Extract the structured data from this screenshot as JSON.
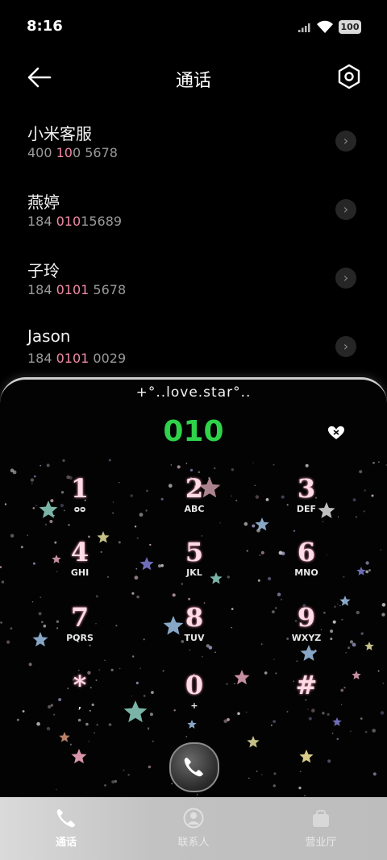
{
  "status": {
    "time": "8:16",
    "battery": "100"
  },
  "header": {
    "title": "通话"
  },
  "contacts": [
    {
      "name": "小米客服",
      "number_parts": [
        "400 ",
        "10",
        "0 5678"
      ]
    },
    {
      "name": "燕婷",
      "number_parts": [
        "184 ",
        "010",
        "15689"
      ]
    },
    {
      "name": "子玲",
      "number_parts": [
        "184 ",
        "0101",
        " 5678"
      ]
    },
    {
      "name": "Jason",
      "number_parts": [
        "184 ",
        "0101",
        " 0029"
      ]
    }
  ],
  "dialer": {
    "theme_label": "+°..love.star°..",
    "display": "010",
    "keys": [
      {
        "digit": "1",
        "letters": "ᴑᴑ"
      },
      {
        "digit": "2",
        "letters": "ABC"
      },
      {
        "digit": "3",
        "letters": "DEF"
      },
      {
        "digit": "4",
        "letters": "GHI"
      },
      {
        "digit": "5",
        "letters": "JKL"
      },
      {
        "digit": "6",
        "letters": "MNO"
      },
      {
        "digit": "7",
        "letters": "PQRS"
      },
      {
        "digit": "8",
        "letters": "TUV"
      },
      {
        "digit": "9",
        "letters": "WXYZ"
      },
      {
        "digit": "*",
        "letters": ","
      },
      {
        "digit": "0",
        "letters": "+"
      },
      {
        "digit": "#",
        "letters": ""
      }
    ]
  },
  "tabs": [
    {
      "label": "通话",
      "icon": "phone-icon",
      "active": true
    },
    {
      "label": "联系人",
      "icon": "person-icon",
      "active": false
    },
    {
      "label": "营业厅",
      "icon": "shopping-bag-icon",
      "active": false
    }
  ],
  "colors": {
    "display_green": "#2fd34a",
    "highlight_pink": "#f08aa6",
    "key_pink": "#ffdbe6"
  }
}
